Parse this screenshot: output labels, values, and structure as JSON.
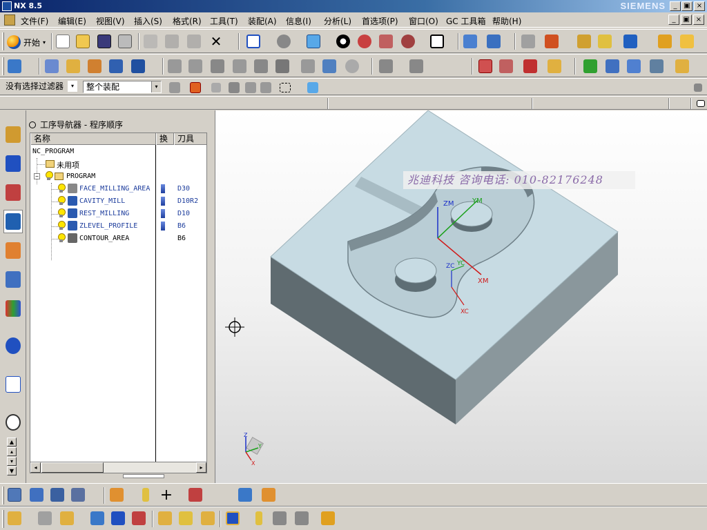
{
  "window": {
    "title": "NX 8.5",
    "brand": "SIEMENS",
    "controls": [
      "_",
      "▣",
      "×"
    ]
  },
  "menu": {
    "items": [
      "文件(F)",
      "编辑(E)",
      "视图(V)",
      "插入(S)",
      "格式(R)",
      "工具(T)",
      "装配(A)",
      "信息(I)",
      "分析(L)",
      "首选项(P)",
      "窗口(O)",
      "GC 工具箱",
      "帮助(H)"
    ]
  },
  "toolbar": {
    "start_label": "开始",
    "selection_filter": "没有选择过滤器",
    "assembly_scope": "整个装配"
  },
  "navigator": {
    "title": "工序导航器 - 程序顺序",
    "columns": [
      "名称",
      "换",
      "刀具"
    ],
    "root": "NC_PROGRAM",
    "unused": "未用项",
    "program": "PROGRAM",
    "operations": [
      {
        "name": "FACE_MILLING_AREA",
        "tool": "D30",
        "changed": true
      },
      {
        "name": "CAVITY_MILL",
        "tool": "D10R2",
        "changed": true
      },
      {
        "name": "REST_MILLING",
        "tool": "D10",
        "changed": true
      },
      {
        "name": "ZLEVEL_PROFILE",
        "tool": "B6",
        "changed": true
      },
      {
        "name": "CONTOUR_AREA",
        "tool": "B6",
        "changed": false
      }
    ]
  },
  "graphics": {
    "watermark": "兆迪科技  咨询电话: 010-82176248",
    "axes": {
      "zm": "ZM",
      "ym": "YM",
      "xm": "XM",
      "zc": "ZC",
      "yc": "YC",
      "xc": "XC"
    },
    "triad": {
      "z": "Z",
      "y": "Y",
      "x": "X"
    },
    "colors": {
      "part_top": "#c7dbe3",
      "part_side_left": "#5f6b70",
      "part_side_right": "#8a979c",
      "axis_green": "#1aa01a",
      "axis_red": "#d01818",
      "axis_blue": "#1a2fc8"
    }
  }
}
